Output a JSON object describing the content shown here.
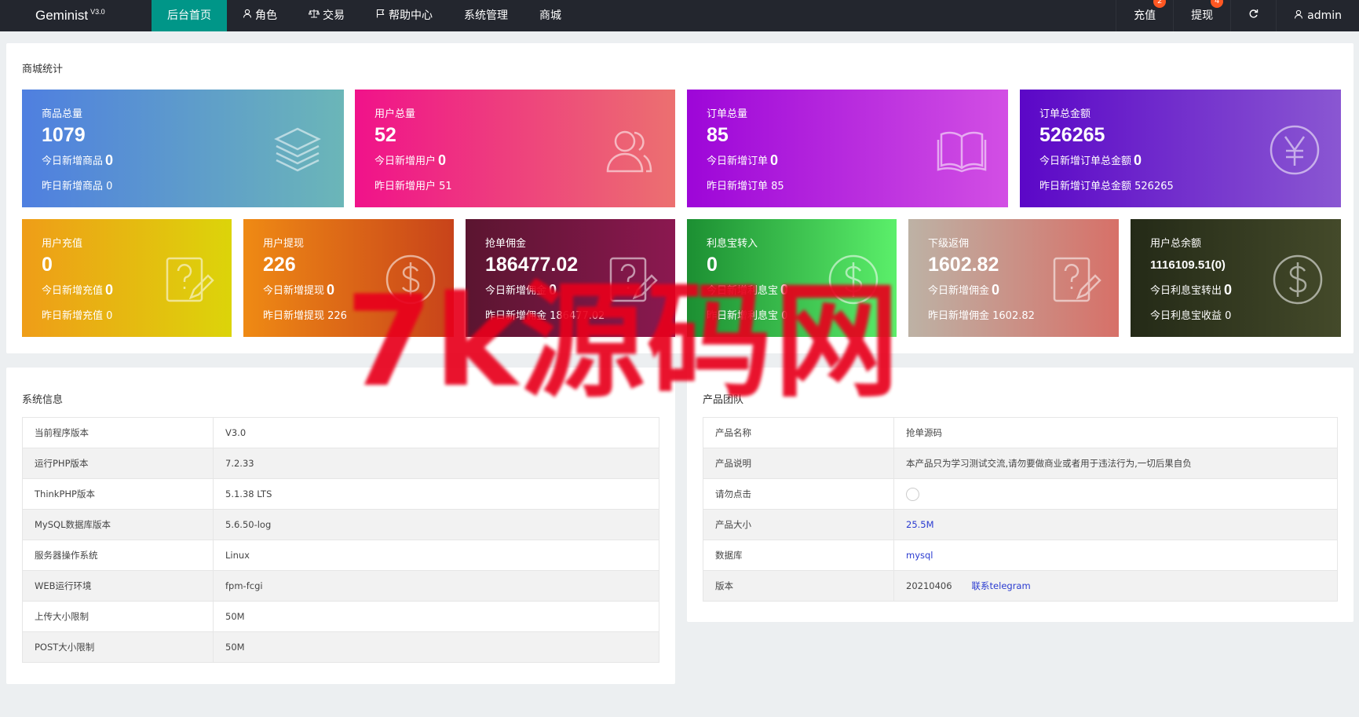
{
  "brand": {
    "name": "Geminist",
    "version": "V3.0"
  },
  "nav": [
    {
      "label": "后台首页",
      "icon": "",
      "active": true
    },
    {
      "label": "角色",
      "icon": "user-icon"
    },
    {
      "label": "交易",
      "icon": "scale-icon"
    },
    {
      "label": "帮助中心",
      "icon": "flag-icon"
    },
    {
      "label": "系统管理",
      "icon": ""
    },
    {
      "label": "商城",
      "icon": ""
    }
  ],
  "right_nav": {
    "recharge": {
      "label": "充值",
      "badge": "2"
    },
    "withdraw": {
      "label": "提现",
      "badge": "4"
    },
    "refresh_icon": "refresh-icon",
    "user": {
      "label": "admin",
      "icon": "user-icon"
    }
  },
  "mall_stats": {
    "title": "商城统计",
    "row1": [
      {
        "label": "商品总量",
        "value": "1079",
        "today_label": "今日新增商品",
        "today": "0",
        "yesterday": "昨日新增商品 0",
        "icon": "layers-icon",
        "gradient": [
          "#4f7fe0",
          "#6bb6b8"
        ]
      },
      {
        "label": "用户总量",
        "value": "52",
        "today_label": "今日新增用户",
        "today": "0",
        "yesterday": "昨日新增用户 51",
        "icon": "users-icon",
        "gradient": [
          "#f0128a",
          "#ec7070"
        ]
      },
      {
        "label": "订单总量",
        "value": "85",
        "today_label": "今日新增订单",
        "today": "0",
        "yesterday": "昨日新增订单 85",
        "icon": "book-icon",
        "gradient": [
          "#9d06d8",
          "#d24fe4"
        ]
      },
      {
        "label": "订单总金额",
        "value": "526265",
        "today_label": "今日新增订单总金额",
        "today": "0",
        "yesterday": "昨日新增订单总金额 526265",
        "icon": "yen-icon",
        "gradient": [
          "#5b07c7",
          "#8a57d2"
        ]
      }
    ],
    "row2": [
      {
        "label": "用户充值",
        "value": "0",
        "today_label": "今日新增充值",
        "today": "0",
        "yesterday": "昨日新增充值 0",
        "icon": "edit-question-icon",
        "gradient": [
          "#ef9d18",
          "#dcd40a"
        ]
      },
      {
        "label": "用户提现",
        "value": "226",
        "today_label": "今日新增提现",
        "today": "0",
        "yesterday": "昨日新增提现 226",
        "icon": "dollar-icon",
        "gradient": [
          "#ef8a14",
          "#c8431a"
        ]
      },
      {
        "label": "抢单佣金",
        "value": "186477.02",
        "today_label": "今日新增佣金",
        "today": "0",
        "yesterday": "昨日新增佣金 186477.02",
        "icon": "edit-question-icon",
        "gradient": [
          "#5b1530",
          "#8b1850"
        ]
      },
      {
        "label": "利息宝转入",
        "value": "0",
        "today_label": "今日新增利息宝",
        "today": "0",
        "yesterday": "昨日新增利息宝 0",
        "icon": "dollar-icon",
        "gradient": [
          "#1c8f32",
          "#5bef6a"
        ]
      },
      {
        "label": "下级返佣",
        "value": "1602.82",
        "today_label": "今日新增佣金",
        "today": "0",
        "yesterday": "昨日新增佣金 1602.82",
        "icon": "edit-question-icon",
        "gradient": [
          "#bdb2a5",
          "#d77068"
        ]
      },
      {
        "label": "用户总余额",
        "value": "1116109.51(0)",
        "today_label": "今日利息宝转出",
        "today": "0",
        "yesterday": "今日利息宝收益 0",
        "icon": "dollar-icon",
        "gradient": [
          "#242a17",
          "#444a2a"
        ]
      }
    ]
  },
  "system_info": {
    "title": "系统信息",
    "rows": [
      {
        "k": "当前程序版本",
        "v": "V3.0"
      },
      {
        "k": "运行PHP版本",
        "v": "7.2.33"
      },
      {
        "k": "ThinkPHP版本",
        "v": "5.1.38 LTS"
      },
      {
        "k": "MySQL数据库版本",
        "v": "5.6.50-log"
      },
      {
        "k": "服务器操作系统",
        "v": "Linux"
      },
      {
        "k": "WEB运行环境",
        "v": "fpm-fcgi"
      },
      {
        "k": "上传大小限制",
        "v": "50M"
      },
      {
        "k": "POST大小限制",
        "v": "50M"
      }
    ]
  },
  "product_team": {
    "title": "产品团队",
    "rows": [
      {
        "k": "产品名称",
        "v": "抢单源码"
      },
      {
        "k": "产品说明",
        "v": "本产品只为学习测试交流,请勿要做商业或者用于违法行为,一切后果自负"
      },
      {
        "k": "请勿点击",
        "v": ""
      },
      {
        "k": "产品大小",
        "v": "25.5M"
      },
      {
        "k": "数据库",
        "v": "mysql"
      },
      {
        "k": "版本",
        "v": "20210406",
        "link": "联系telegram"
      }
    ]
  },
  "watermark": "7k源码网"
}
